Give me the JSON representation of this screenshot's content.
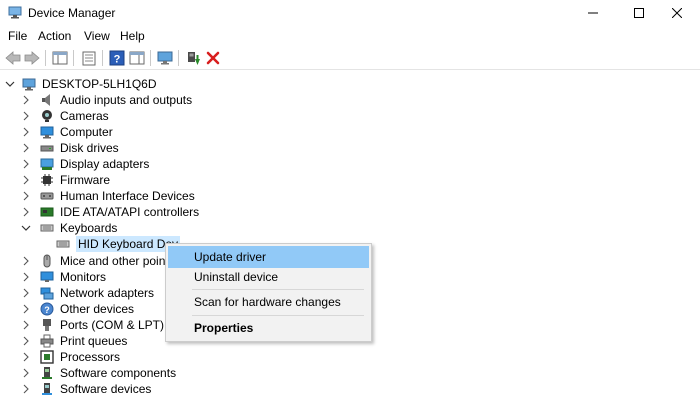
{
  "window": {
    "title": "Device Manager"
  },
  "menu": [
    "File",
    "Action",
    "View",
    "Help"
  ],
  "toolbar": {
    "buttons": [
      "back-arrow-icon",
      "forward-arrow-icon",
      "show-hide-tree-icon",
      "properties-sheet-icon",
      "help-icon",
      "action-pane-icon",
      "scan-monitor-icon",
      "update-driver-icon",
      "uninstall-x-icon"
    ],
    "accent_green": "#2a8a2a",
    "delete_red": "#d81e1e"
  },
  "tree": {
    "root": "DESKTOP-5LH1Q6D",
    "items": [
      {
        "label": "Audio inputs and outputs",
        "icon": "speaker-icon"
      },
      {
        "label": "Cameras",
        "icon": "camera-icon"
      },
      {
        "label": "Computer",
        "icon": "computer-icon"
      },
      {
        "label": "Disk drives",
        "icon": "disk-drive-icon"
      },
      {
        "label": "Display adapters",
        "icon": "display-adapter-icon"
      },
      {
        "label": "Firmware",
        "icon": "firmware-chip-icon"
      },
      {
        "label": "Human Interface Devices",
        "icon": "hid-icon"
      },
      {
        "label": "IDE ATA/ATAPI controllers",
        "icon": "ide-controller-icon"
      },
      {
        "label": "Keyboards",
        "icon": "keyboard-icon",
        "expanded": true
      },
      {
        "label": "HID Keyboard Dev",
        "icon": "keyboard-icon",
        "child": true,
        "selected": true
      },
      {
        "label": "Mice and other pointi",
        "icon": "mouse-icon"
      },
      {
        "label": "Monitors",
        "icon": "monitor-icon"
      },
      {
        "label": "Network adapters",
        "icon": "network-adapter-icon"
      },
      {
        "label": "Other devices",
        "icon": "unknown-device-icon"
      },
      {
        "label": "Ports (COM & LPT)",
        "icon": "port-icon"
      },
      {
        "label": "Print queues",
        "icon": "printer-icon"
      },
      {
        "label": "Processors",
        "icon": "processor-icon"
      },
      {
        "label": "Software components",
        "icon": "software-component-icon"
      },
      {
        "label": "Software devices",
        "icon": "software-device-icon"
      }
    ],
    "selection_color": "#cce8ff"
  },
  "context_menu": {
    "items": [
      "Update driver",
      "Uninstall device",
      "Scan for hardware changes",
      "Properties"
    ],
    "highlight_color": "#91c9f7"
  }
}
